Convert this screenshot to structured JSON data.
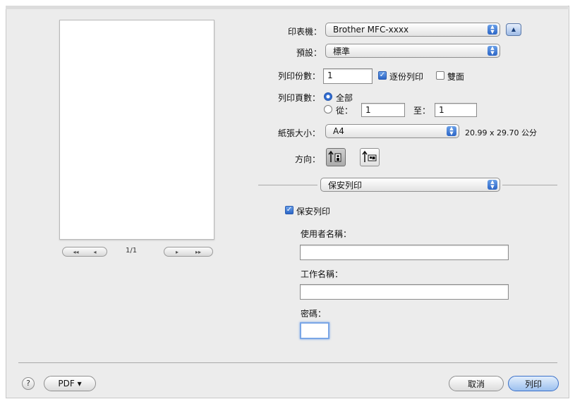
{
  "printer": {
    "label": "印表機：",
    "value": "Brother MFC-xxxx",
    "toggle_icon": "disclosure-up-icon"
  },
  "presets": {
    "label": "預設：",
    "value": "標準"
  },
  "copies": {
    "label": "列印份數：",
    "value": "1",
    "collated_label": "逐份列印",
    "collated_checked": true,
    "duplex_label": "雙面",
    "duplex_checked": false
  },
  "pages": {
    "label": "列印頁數：",
    "all_label": "全部",
    "all_selected": true,
    "from_label": "從：",
    "from_value": "1",
    "to_label": "至：",
    "to_value": "1"
  },
  "paper_size": {
    "label": "紙張大小：",
    "value": "A4",
    "dimensions": "20.99 x 29.70 公分"
  },
  "orientation": {
    "label": "方向：",
    "portrait_selected": true
  },
  "section_popup": {
    "value": "保安列印"
  },
  "secure_print": {
    "checkbox_label": "保安列印",
    "checked": true,
    "username_label": "使用者名稱：",
    "username_value": "",
    "jobname_label": "工作名稱：",
    "jobname_value": "",
    "password_label": "密碼：",
    "password_value": ""
  },
  "preview_nav": {
    "page_indicator": "1/1",
    "first": "◂◂",
    "prev": "◂",
    "next": "▸",
    "last": "▸▸"
  },
  "footer": {
    "help": "?",
    "pdf": "PDF ▾",
    "cancel": "取消",
    "print": "列印"
  },
  "colors": {
    "accent": "#2f6bd0",
    "background": "#ececec"
  }
}
